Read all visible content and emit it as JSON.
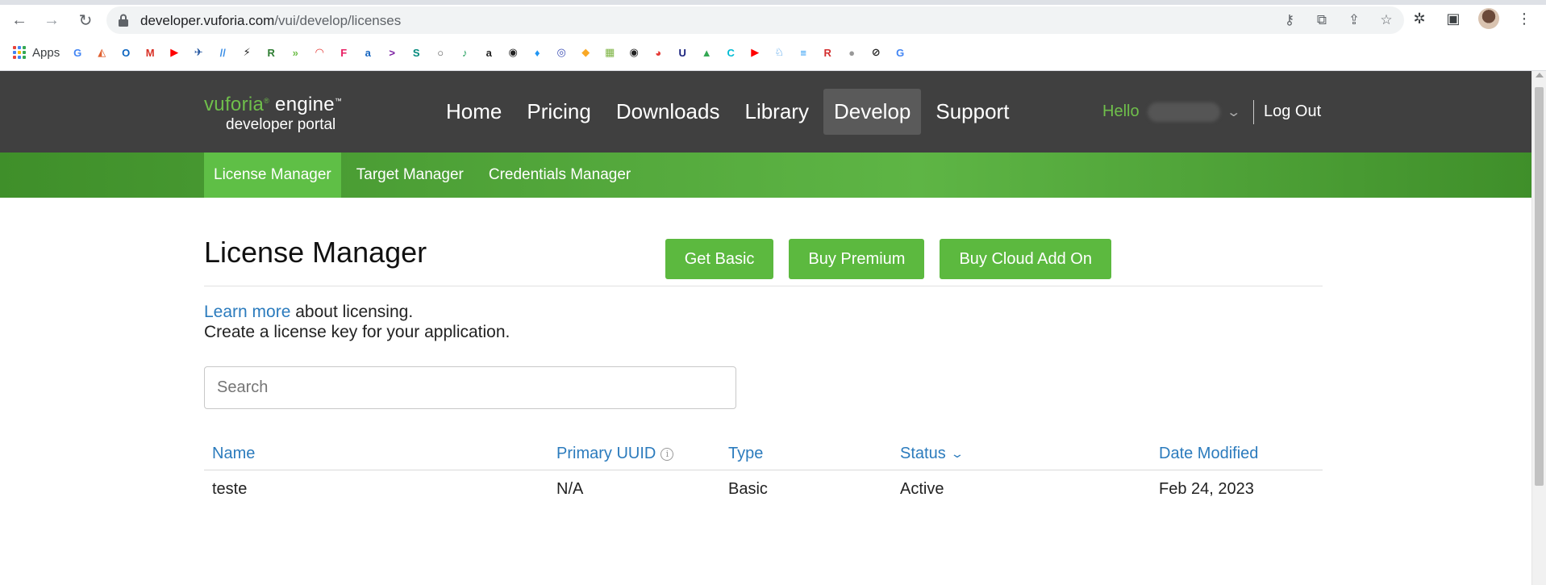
{
  "browser": {
    "url_host": "developer.vuforia.com",
    "url_path": "/vui/develop/licenses",
    "apps_label": "Apps",
    "bookmarks": [
      {
        "icon": "google-icon",
        "glyph": "G",
        "color": "#4285f4"
      },
      {
        "icon": "drive-shortcut-icon",
        "glyph": "◭",
        "color": "#e06030"
      },
      {
        "icon": "outlook-icon",
        "glyph": "O",
        "color": "#0a64c0"
      },
      {
        "icon": "gmail-icon",
        "glyph": "M",
        "color": "#d93025"
      },
      {
        "icon": "youtube-icon",
        "glyph": "▶",
        "color": "#ff0000"
      },
      {
        "icon": "app-icon",
        "glyph": "✈",
        "color": "#1b4f9c"
      },
      {
        "icon": "slash-icon",
        "glyph": "//",
        "color": "#3a8ee6"
      },
      {
        "icon": "bolt-icon",
        "glyph": "⚡",
        "color": "#222222"
      },
      {
        "icon": "pr-icon",
        "glyph": "R",
        "color": "#2e7d32"
      },
      {
        "icon": "arrow-icon",
        "glyph": "»",
        "color": "#6fbf4b"
      },
      {
        "icon": "cursor-icon",
        "glyph": "◠",
        "color": "#e53935"
      },
      {
        "icon": "f-icon",
        "glyph": "F",
        "color": "#e91e63"
      },
      {
        "icon": "a-icon",
        "glyph": "a",
        "color": "#1565c0"
      },
      {
        "icon": "accenture-icon",
        "glyph": ">",
        "color": "#7b1fa2"
      },
      {
        "icon": "s-icon",
        "glyph": "S",
        "color": "#00897b"
      },
      {
        "icon": "bulb-icon",
        "glyph": "○",
        "color": "#555555"
      },
      {
        "icon": "circle-icon",
        "glyph": "♪",
        "color": "#1e9e5a"
      },
      {
        "icon": "amazon-icon",
        "glyph": "a",
        "color": "#222222"
      },
      {
        "icon": "globe-icon",
        "glyph": "◉",
        "color": "#222222"
      },
      {
        "icon": "drop-icon",
        "glyph": "♦",
        "color": "#2196f3"
      },
      {
        "icon": "target-icon",
        "glyph": "◎",
        "color": "#3f51b5"
      },
      {
        "icon": "shield-icon",
        "glyph": "◆",
        "color": "#f9a825"
      },
      {
        "icon": "pages-icon",
        "glyph": "▦",
        "color": "#7cb342"
      },
      {
        "icon": "globe2-icon",
        "glyph": "◉",
        "color": "#222222"
      },
      {
        "icon": "cat-icon",
        "glyph": "◕",
        "color": "#e53935"
      },
      {
        "icon": "unuvali-icon",
        "glyph": "U",
        "color": "#1a237e"
      },
      {
        "icon": "gdrive-icon",
        "glyph": "▲",
        "color": "#34a853"
      },
      {
        "icon": "c-icon",
        "glyph": "C",
        "color": "#00bcd4"
      },
      {
        "icon": "youtube2-icon",
        "glyph": "▶",
        "color": "#ff0000"
      },
      {
        "icon": "hand-icon",
        "glyph": "♘",
        "color": "#1e88e5"
      },
      {
        "icon": "doc-icon",
        "glyph": "≡",
        "color": "#2196f3"
      },
      {
        "icon": "r-icon",
        "glyph": "R",
        "color": "#d32f2f"
      },
      {
        "icon": "apple-icon",
        "glyph": "●",
        "color": "#999999"
      },
      {
        "icon": "slash-circle-icon",
        "glyph": "⊘",
        "color": "#222222"
      },
      {
        "icon": "google2-icon",
        "glyph": "G",
        "color": "#4285f4"
      }
    ]
  },
  "header": {
    "logo_vuforia": "vuforia",
    "logo_engine": "engine",
    "logo_tm": "™",
    "logo_sub": "developer portal",
    "nav": [
      {
        "label": "Home",
        "active": false
      },
      {
        "label": "Pricing",
        "active": false
      },
      {
        "label": "Downloads",
        "active": false
      },
      {
        "label": "Library",
        "active": false
      },
      {
        "label": "Develop",
        "active": true
      },
      {
        "label": "Support",
        "active": false
      }
    ],
    "hello": "Hello",
    "logout": "Log Out"
  },
  "subnav": [
    {
      "label": "License Manager",
      "active": true
    },
    {
      "label": "Target Manager",
      "active": false
    },
    {
      "label": "Credentials Manager",
      "active": false
    }
  ],
  "page": {
    "title": "License Manager",
    "buttons": [
      "Get Basic",
      "Buy Premium",
      "Buy Cloud Add On"
    ],
    "learn_more": "Learn more",
    "about_text": " about licensing.",
    "create_text": "Create a license key for your application.",
    "search_placeholder": "Search"
  },
  "table": {
    "headers": [
      "Name",
      "Primary UUID",
      "Type",
      "Status",
      "Date Modified"
    ],
    "rows": [
      [
        "teste",
        "N/A",
        "Basic",
        "Active",
        "Feb 24, 2023"
      ]
    ]
  },
  "colors": {
    "header_bg": "#404040",
    "brand_green": "#5cb93f",
    "link_blue": "#2b7bbd"
  }
}
